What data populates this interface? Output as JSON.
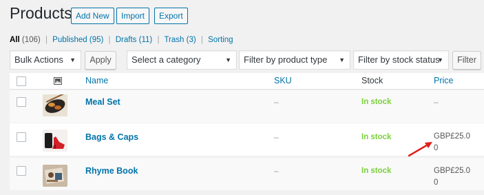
{
  "header": {
    "title": "Products",
    "add_new": "Add New",
    "import": "Import",
    "export": "Export"
  },
  "filters": {
    "all": "All",
    "all_count": "(106)",
    "published": "Published",
    "published_count": "(95)",
    "drafts": "Drafts",
    "drafts_count": "(11)",
    "trash": "Trash",
    "trash_count": "(3)",
    "sorting": "Sorting",
    "separator": "|"
  },
  "toolbar": {
    "bulk_actions": "Bulk Actions",
    "apply": "Apply",
    "category": "Select a category",
    "product_type": "Filter by product type",
    "stock_status": "Filter by stock status",
    "filter": "Filter"
  },
  "columns": {
    "name": "Name",
    "sku": "SKU",
    "stock": "Stock",
    "price": "Price"
  },
  "rows": [
    {
      "name": "Meal Set",
      "sku": "–",
      "stock": "In stock",
      "price": "–",
      "thumb": "food-thumbnail"
    },
    {
      "name": "Bags & Caps",
      "sku": "–",
      "stock": "In stock",
      "price": "GBP£25.00",
      "thumb": "shoes-thumbnail"
    },
    {
      "name": "Rhyme Book",
      "sku": "–",
      "stock": "In stock",
      "price": "GBP£25.00",
      "thumb": "book-thumbnail"
    }
  ],
  "colors": {
    "link": "#0073aa",
    "in_stock": "#7ad03a",
    "annotation_arrow": "#e0201b"
  },
  "icons": {
    "image_column": "image-icon",
    "annotation": "red-arrow-icon"
  }
}
